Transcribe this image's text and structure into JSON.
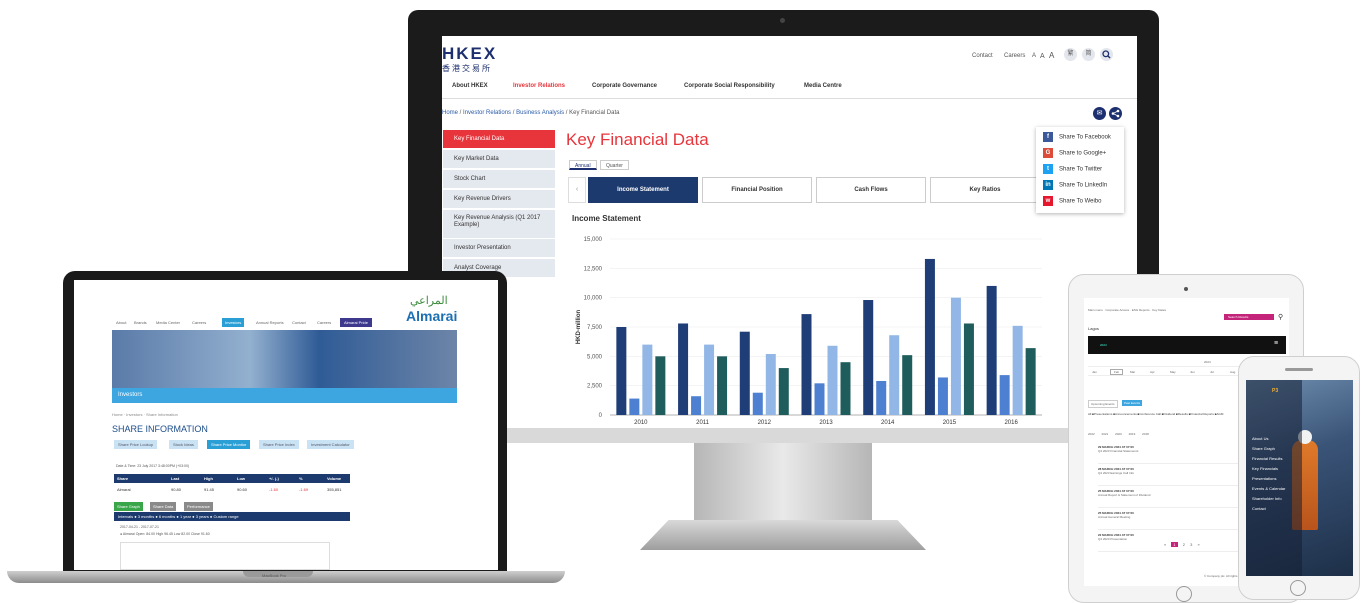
{
  "hkex": {
    "logo": "HKEX",
    "logo_cn": "香港交易所",
    "utility": {
      "contact": "Contact",
      "careers": "Careers",
      "font_sizes": [
        "A",
        "A",
        "A"
      ],
      "lang_1": "繁",
      "lang_2": "简"
    },
    "nav": [
      "About HKEX",
      "Investor Relations",
      "Corporate Governance",
      "Corporate Social Responsibility",
      "Media Centre"
    ],
    "breadcrumb": {
      "home": "Home",
      "sep": " / ",
      "ir": "Investor Relations",
      "ba": "Business Analysis",
      "current": "Key Financial Data"
    },
    "sidebar": [
      "Key Financial Data",
      "Key Market Data",
      "Stock Chart",
      "Key Revenue Drivers",
      "Key Revenue Analysis (Q1 2017 Example)",
      "Investor Presentation",
      "Analyst Coverage"
    ],
    "page_title": "Key Financial Data",
    "period_tabs": [
      "Annual",
      "Quarter"
    ],
    "tabs": [
      "Income Statement",
      "Financial Position",
      "Cash Flows",
      "Key Ratios"
    ],
    "section_title": "Income Statement",
    "share_menu": [
      "Share To Facebook",
      "Share to Google+",
      "Share To Twitter",
      "Share To LinkedIn",
      "Share To Weibo"
    ]
  },
  "chart_data": {
    "type": "bar",
    "title": "Income Statement",
    "ylabel": "HKD-million",
    "categories": [
      "2010",
      "2011",
      "2012",
      "2013",
      "2014",
      "2015",
      "2016"
    ],
    "ylim": [
      0,
      15000
    ],
    "yticks": [
      "15,000",
      "12,500",
      "10,000",
      "7,500",
      "5,000",
      "2,500",
      "0"
    ],
    "series": [
      {
        "values": [
          7500,
          7800,
          7100,
          8600,
          9800,
          13300,
          11000
        ],
        "color": "#1f3e78"
      },
      {
        "values": [
          1400,
          1600,
          1900,
          2700,
          2900,
          3200,
          3400
        ],
        "color": "#4d80d0"
      },
      {
        "values": [
          6000,
          6000,
          5200,
          5900,
          6800,
          10000,
          7600
        ],
        "color": "#92b7e6"
      },
      {
        "values": [
          5000,
          5000,
          4000,
          4500,
          5100,
          7800,
          5700
        ],
        "color": "#1f5c5c"
      }
    ]
  },
  "almarai": {
    "nav": [
      "About",
      "Brands",
      "Media Center",
      "Careers",
      "Investors",
      "Annual Reports",
      "Contact",
      "Careers"
    ],
    "cta": "Almarai Pride",
    "logo": "Almarai",
    "logo_ar": "المراعي",
    "hero_label": "Investors",
    "breadcrumb": "Home · Investors · Share Information",
    "title": "SHARE INFORMATION",
    "tabs": [
      "Share Price Lookup",
      "Stock Ideas",
      "Share Price Monitor",
      "Share Price Index",
      "Investment Calculator"
    ],
    "date": "Date & Time: 23 July 2017 3:48:00PM (+03:00)",
    "table_head": [
      "Share",
      "Last",
      "High",
      "Low",
      "+/- (-)",
      "%",
      "Volume"
    ],
    "table_row": [
      "Almarai",
      "90.80",
      "91.45",
      "90.60",
      "-1.60",
      "-1.69",
      "355,851"
    ],
    "buttons": [
      "Share Graph",
      "Share Data",
      "Performance"
    ],
    "range_bar": "Intervals   ● 3 months ● 6 months ● 1 year ● 3 years ● Custom range",
    "note_1": "2017-04-21 - 2017-07-21",
    "note_2": "● Almarai Open: 84.00 High 96.45 Low 82.00 Close 91.60",
    "bezel": "MacBook Pro"
  },
  "tablet": {
    "header_links": "Main menu · Corporate Access · ESG Reports · Key Dates",
    "search_btn": "Search Results",
    "brand": "Lagos",
    "app_label": "2024",
    "months": [
      "Jan",
      "Feb",
      "Mar",
      "Apr",
      "May",
      "Jun",
      "Jul",
      "Aug",
      "Sep",
      "Oct"
    ],
    "year": "2024",
    "filters": [
      "Upcoming Events",
      "Past Events"
    ],
    "checks": [
      "All",
      "Presentations",
      "Announcements",
      "Conference Call",
      "Dividend",
      "Results",
      "Financial Reports",
      "AGM"
    ],
    "years": [
      "2022",
      "2021",
      "2020",
      "2019",
      "2018"
    ],
    "items": [
      {
        "date": "29 MARCH 2024 AT 07:00",
        "text": "Q4 2023 Financial Statements"
      },
      {
        "date": "28 MARCH 2024 AT 07:00",
        "text": "Q4 2023 Earnings Call Info"
      },
      {
        "date": "25 MARCH 2024 AT 07:00",
        "text": "Annual Report & Statement of Dividend"
      },
      {
        "date": "25 MARCH 2024 AT 07:00",
        "text": "Annual General Meeting"
      },
      {
        "date": "22 MARCH 2024 AT 07:00",
        "text": "Q4 2023 Presentation"
      }
    ],
    "pager": [
      "«",
      "1",
      "2",
      "3",
      "»"
    ],
    "footer": "© Company plc. All rights reserved"
  },
  "phone": {
    "logo": "P3",
    "menu": [
      "About Us",
      "Share Graph",
      "Financial Results",
      "Key Financials",
      "Presentations",
      "Events & Calendar",
      "Shareholder Info",
      "Contact"
    ]
  },
  "colors": {
    "hkex_red": "#e8353c",
    "hkex_navy": "#1d3a6e",
    "almarai_blue": "#2a9fd6"
  }
}
